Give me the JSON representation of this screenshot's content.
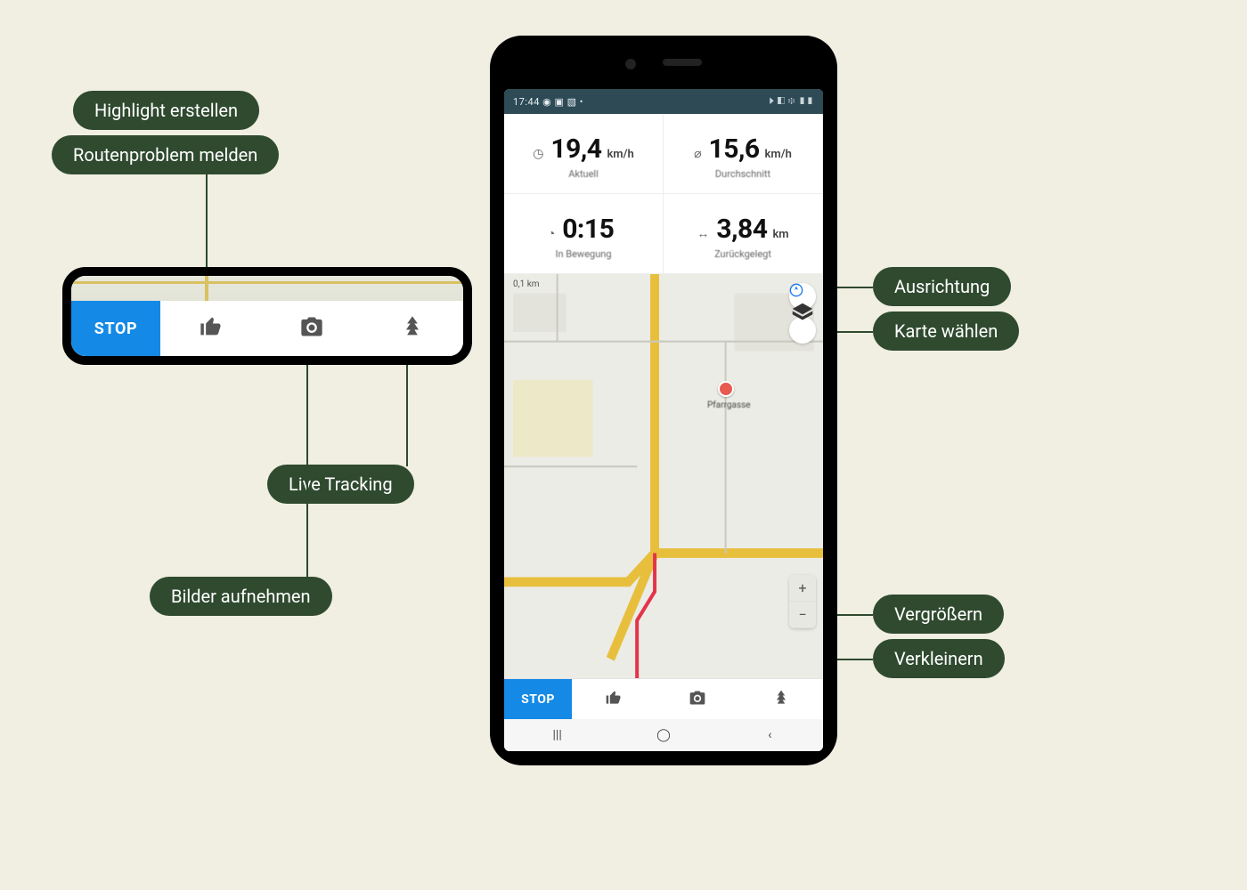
{
  "annotations": {
    "highlight_create": "Highlight erstellen",
    "route_problem": "Routenproblem melden",
    "live_tracking": "Live Tracking",
    "take_photos": "Bilder aufnehmen",
    "orientation": "Ausrichtung",
    "choose_map": "Karte wählen",
    "zoom_in": "Vergrößern",
    "zoom_out": "Verkleinern"
  },
  "inset": {
    "stop_label": "STOP"
  },
  "phone": {
    "statusbar": {
      "time": "17:44",
      "left_icons": "◉ ▣ ▧ •",
      "right_icons": "⏵ ◧ ፨ ▮▮"
    },
    "metrics": {
      "current_speed": {
        "value": "19,4",
        "unit": "km/h",
        "label": "Aktuell",
        "icon": "◷"
      },
      "avg_speed": {
        "value": "15,6",
        "unit": "km/h",
        "label": "Durchschnitt",
        "icon": "⌀"
      },
      "moving_time": {
        "value": "0:15",
        "unit": "",
        "label": "In Bewegung",
        "icon": "◔"
      },
      "distance": {
        "value": "3,84",
        "unit": "km",
        "label": "Zurückgelegt",
        "icon": "↔"
      }
    },
    "map": {
      "scale_label": "0,1 km",
      "poi_label": "Pfarrgasse"
    },
    "actionbar": {
      "stop_label": "STOP"
    }
  },
  "colors": {
    "pill_bg": "#2f4a2f",
    "accent_blue": "#148ae6",
    "page_bg": "#f0efe1"
  }
}
